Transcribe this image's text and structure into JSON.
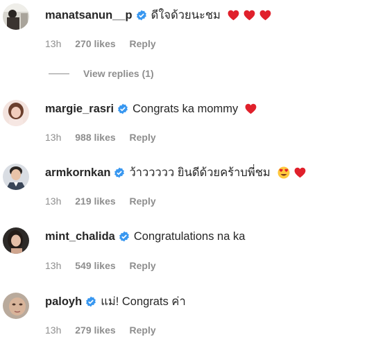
{
  "comments": [
    {
      "username": "manatsanun__p",
      "text": "ดีใจด้วยนะชม",
      "emojis": [
        "heart-icon",
        "heart-icon",
        "heart-icon"
      ],
      "time": "13h",
      "likes": "270 likes",
      "reply": "Reply",
      "view_replies": "View replies (1)"
    },
    {
      "username": "margie_rasri",
      "text": "Congrats ka mommy",
      "emojis": [
        "heart-icon"
      ],
      "time": "13h",
      "likes": "988 likes",
      "reply": "Reply"
    },
    {
      "username": "armkornkan",
      "text": "ว้าววววว ยินดีด้วยคร้าบพี่ชม",
      "emojis": [
        "heart-eyes-icon",
        "heart-icon"
      ],
      "time": "13h",
      "likes": "219 likes",
      "reply": "Reply"
    },
    {
      "username": "mint_chalida",
      "text": "Congratulations na ka",
      "emojis": [],
      "time": "13h",
      "likes": "549 likes",
      "reply": "Reply"
    },
    {
      "username": "paloyh",
      "text": "แม่! Congrats ค่า",
      "emojis": [],
      "time": "13h",
      "likes": "279 likes",
      "reply": "Reply"
    }
  ],
  "colors": {
    "verified": "#3897f0",
    "heart": "#e0202b",
    "meta": "#8e8e8e",
    "text": "#262626"
  }
}
